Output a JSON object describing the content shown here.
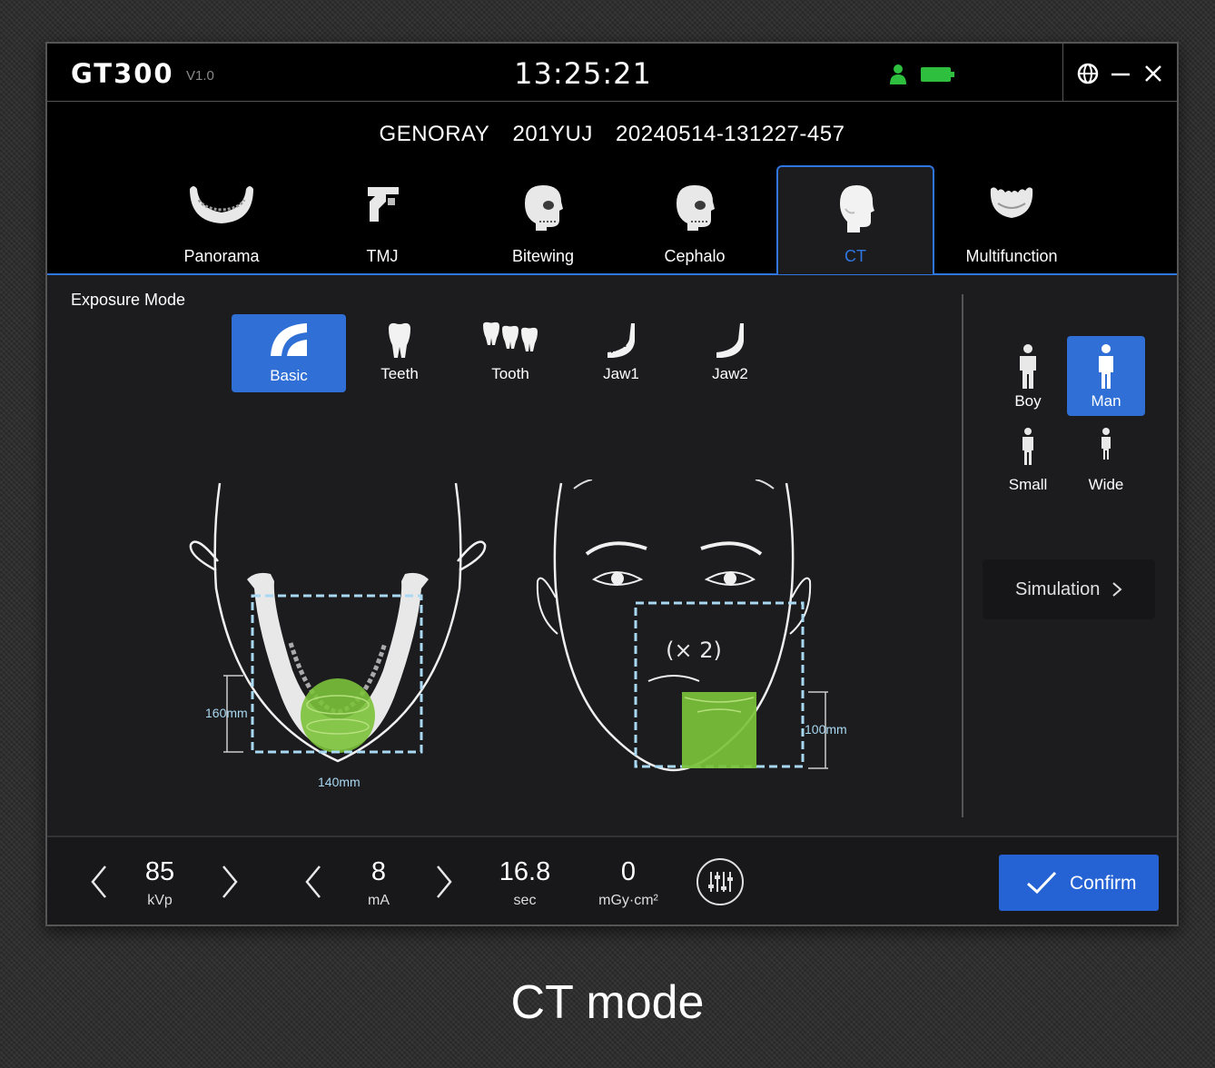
{
  "app": {
    "title": "GT300",
    "version": "V1.0",
    "time": "13:25:21"
  },
  "patient": {
    "vendor": "GENORAY",
    "id": "201YUJ",
    "study": "20240514-131227-457"
  },
  "tabs": [
    {
      "label": "Panorama",
      "icon": "jaw-icon"
    },
    {
      "label": "TMJ",
      "icon": "tmj-icon"
    },
    {
      "label": "Bitewing",
      "icon": "skull-icon"
    },
    {
      "label": "Cephalo",
      "icon": "skull-icon"
    },
    {
      "label": "CT",
      "icon": "head-icon",
      "active": true
    },
    {
      "label": "Multifunction",
      "icon": "teeth-arch-icon"
    }
  ],
  "exposure": {
    "title": "Exposure Mode",
    "modes": [
      {
        "label": "Basic",
        "active": true
      },
      {
        "label": "Teeth"
      },
      {
        "label": "Tooth"
      },
      {
        "label": "Jaw1"
      },
      {
        "label": "Jaw2"
      }
    ]
  },
  "diagram": {
    "height_label": "160mm",
    "width_label": "140mm",
    "multiplier": "(× 2)",
    "front_height_label": "100mm"
  },
  "body_types": [
    {
      "label": "Boy"
    },
    {
      "label": "Man",
      "active": true
    },
    {
      "label": "Small"
    },
    {
      "label": "Wide"
    }
  ],
  "simulation_label": "Simulation",
  "params": {
    "kvp": {
      "value": "85",
      "unit": "kVp"
    },
    "ma": {
      "value": "8",
      "unit": "mA"
    },
    "sec": {
      "value": "16.8",
      "unit": "sec"
    },
    "dose": {
      "value": "0",
      "unit": "mGy·cm²"
    }
  },
  "confirm_label": "Confirm",
  "caption": "CT mode",
  "colors": {
    "accent": "#2f6fd6",
    "status_green": "#2fbf3f",
    "roi_green": "#7bc23a",
    "roi_outline": "#a9d8f2"
  }
}
